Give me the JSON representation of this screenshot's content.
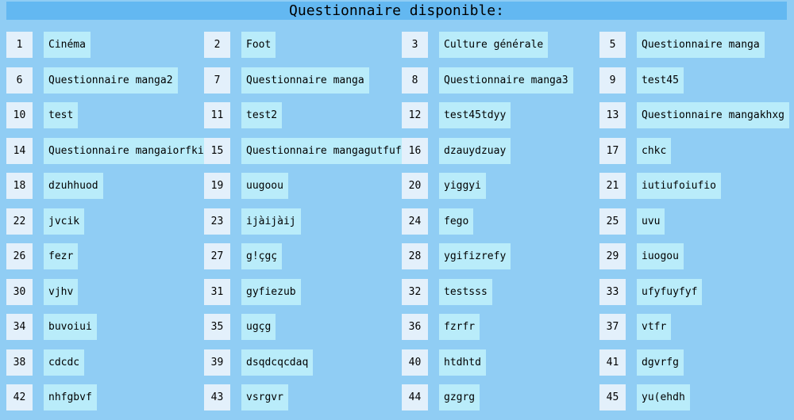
{
  "header": {
    "title": "Questionnaire disponible:"
  },
  "questionnaires": [
    {
      "id": "1",
      "name": "Cinéma"
    },
    {
      "id": "2",
      "name": "Foot"
    },
    {
      "id": "3",
      "name": "Culture générale"
    },
    {
      "id": "5",
      "name": "Questionnaire manga"
    },
    {
      "id": "6",
      "name": "Questionnaire manga2"
    },
    {
      "id": "7",
      "name": "Questionnaire manga"
    },
    {
      "id": "8",
      "name": "Questionnaire manga3"
    },
    {
      "id": "9",
      "name": "test45"
    },
    {
      "id": "10",
      "name": "test"
    },
    {
      "id": "11",
      "name": "test2"
    },
    {
      "id": "12",
      "name": "test45tdyy"
    },
    {
      "id": "13",
      "name": "Questionnaire mangakhxg"
    },
    {
      "id": "14",
      "name": "Questionnaire mangaiorfki"
    },
    {
      "id": "15",
      "name": "Questionnaire mangagutfuft"
    },
    {
      "id": "16",
      "name": "dzauydzuay"
    },
    {
      "id": "17",
      "name": "chkc"
    },
    {
      "id": "18",
      "name": "dzuhhuod"
    },
    {
      "id": "19",
      "name": "uugoou"
    },
    {
      "id": "20",
      "name": "yiggyi"
    },
    {
      "id": "21",
      "name": "iutiufoiufio"
    },
    {
      "id": "22",
      "name": "jvcik"
    },
    {
      "id": "23",
      "name": "ijàijàij"
    },
    {
      "id": "24",
      "name": "fego"
    },
    {
      "id": "25",
      "name": "uvu"
    },
    {
      "id": "26",
      "name": "fezr"
    },
    {
      "id": "27",
      "name": "g!çgç"
    },
    {
      "id": "28",
      "name": "ygifizrefy"
    },
    {
      "id": "29",
      "name": "iuogou"
    },
    {
      "id": "30",
      "name": "vjhv"
    },
    {
      "id": "31",
      "name": "gyfiezub"
    },
    {
      "id": "32",
      "name": "testsss"
    },
    {
      "id": "33",
      "name": "ufyfuyfyf"
    },
    {
      "id": "34",
      "name": "buvoiui"
    },
    {
      "id": "35",
      "name": "ugçg"
    },
    {
      "id": "36",
      "name": "fzrfr"
    },
    {
      "id": "37",
      "name": "vtfr"
    },
    {
      "id": "38",
      "name": "cdcdc"
    },
    {
      "id": "39",
      "name": "dsqdcqcdaq"
    },
    {
      "id": "40",
      "name": "htdhtd"
    },
    {
      "id": "41",
      "name": "dgvrfg"
    },
    {
      "id": "42",
      "name": "nhfgbvf"
    },
    {
      "id": "43",
      "name": "vsrgvr"
    },
    {
      "id": "44",
      "name": "gzgrg"
    },
    {
      "id": "45",
      "name": "yu(ehdh"
    }
  ]
}
